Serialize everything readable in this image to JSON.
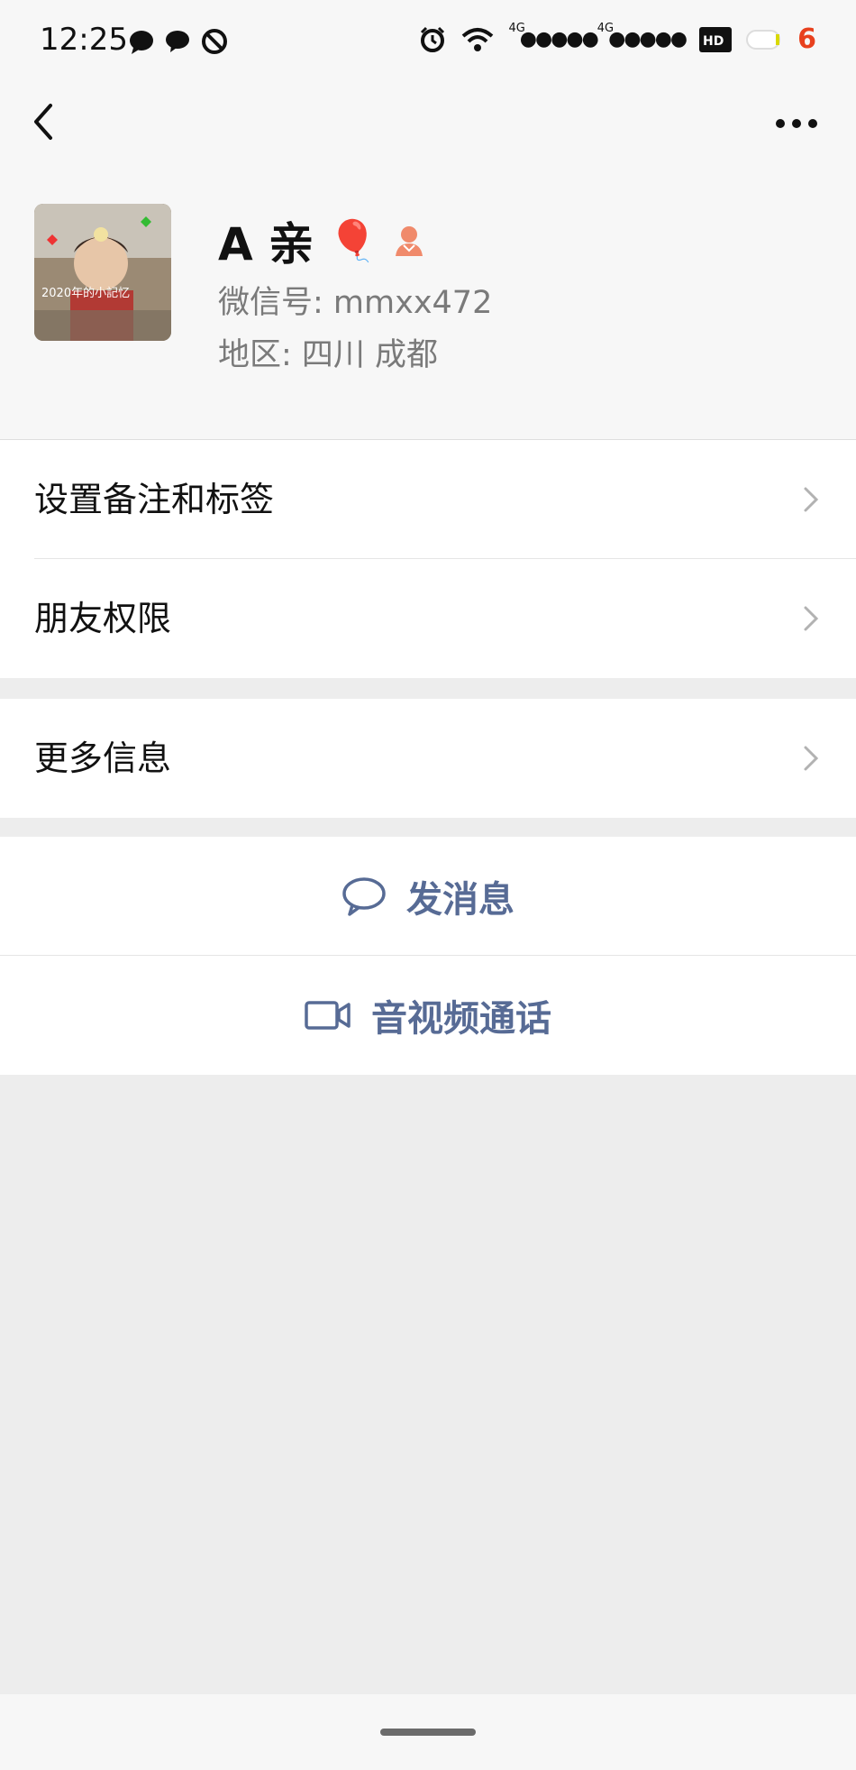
{
  "status_bar": {
    "time": "12:25",
    "network_1": "4G",
    "network_2": "4G",
    "battery_level": "6",
    "icons": [
      "chat-bubble-icon",
      "message-icon",
      "do-not-disturb-icon",
      "alarm-icon",
      "wifi-icon",
      "signal-icon",
      "hd-icon",
      "battery-icon"
    ]
  },
  "nav": {
    "back_icon": "chevron-left-icon",
    "more_icon": "more-dots-icon"
  },
  "profile": {
    "name": "A 亲",
    "name_emoji": "🎈",
    "wechat_id": "微信号: mmxx472",
    "region": "地区: 四川  成都",
    "avatar_caption": "2020年的小記忆"
  },
  "menu": {
    "remark_tags": "设置备注和标签",
    "friend_permissions": "朋友权限",
    "more_info": "更多信息"
  },
  "actions": {
    "send_message": "发消息",
    "video_call": "音视频通话"
  },
  "colors": {
    "link_blue": "#576b95",
    "background": "#ededed",
    "battery_red": "#e8411e"
  }
}
